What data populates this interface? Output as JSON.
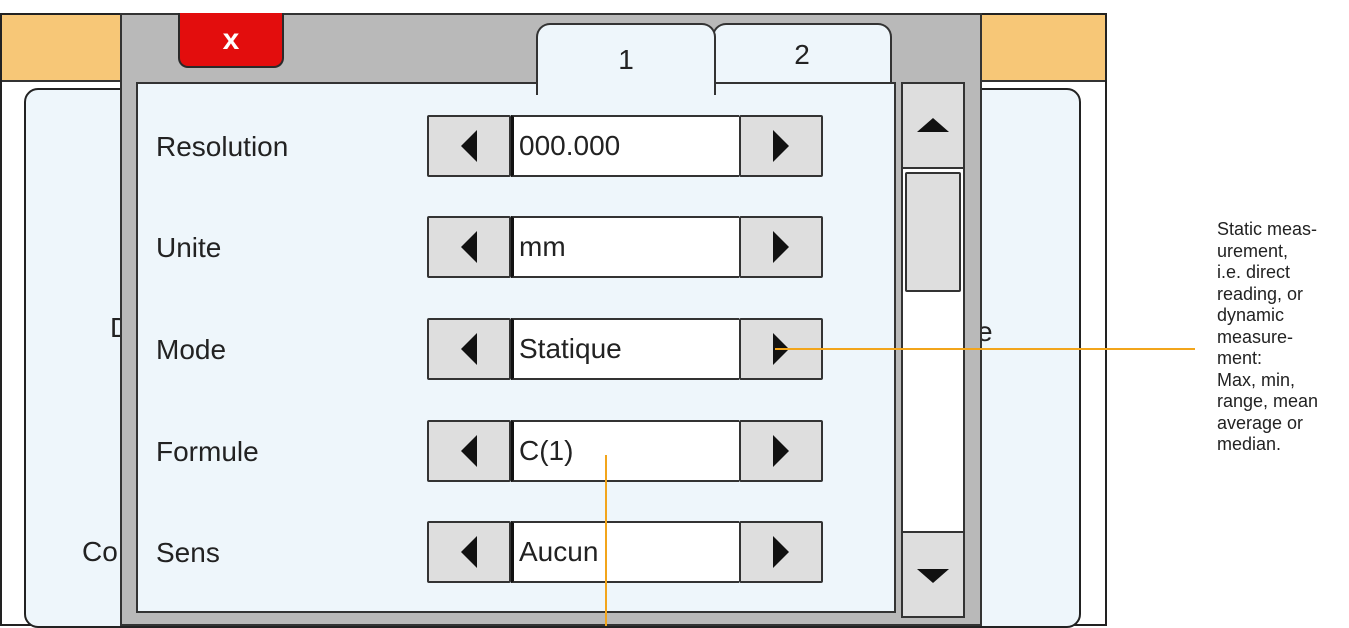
{
  "background": {
    "left_text_1": "D",
    "right_text_1": "e",
    "left_text_2": "Co"
  },
  "dialog": {
    "close_label": "x",
    "tabs": [
      {
        "label": "1",
        "active": true
      },
      {
        "label": "2",
        "active": false
      }
    ],
    "rows": [
      {
        "label": "Resolution",
        "value": "000.000"
      },
      {
        "label": "Unite",
        "value": "mm"
      },
      {
        "label": "Mode",
        "value": "Statique"
      },
      {
        "label": "Formule",
        "value": "C(1)"
      },
      {
        "label": "Sens",
        "value": "Aucun"
      }
    ]
  },
  "annotation": {
    "text": "Static meas-\nurement,\ni.e. direct\nreading, or\ndynamic\nmeasure-\nment:\nMax, min,\nrange, mean\naverage or\nmedian."
  },
  "colors": {
    "top_band": "#f7c777",
    "panel_bg": "#eef6fb",
    "close_button": "#e30d0d",
    "callout": "#f2a51b"
  }
}
